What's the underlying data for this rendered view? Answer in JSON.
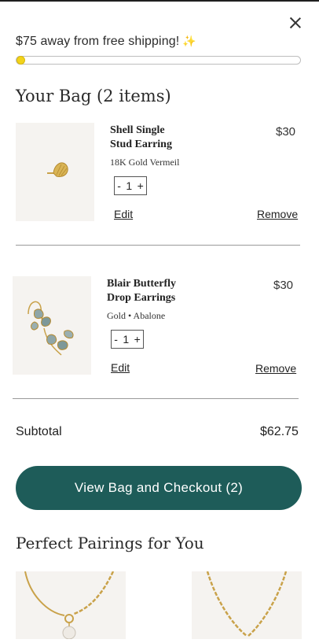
{
  "shipping": {
    "message": "$75 away from free shipping!",
    "sparkle": "✨",
    "progress_fraction": 0.0
  },
  "bag": {
    "title": "Your Bag (2 items)",
    "items": [
      {
        "name": "Shell Single Stud Earring",
        "variant": "18K Gold Vermeil",
        "price": "$30",
        "qty": "1",
        "minus": "-",
        "plus": "+",
        "edit": "Edit",
        "remove": "Remove",
        "image": "shell-stud-earring"
      },
      {
        "name": "Blair Butterfly Drop Earrings",
        "variant": "Gold • Abalone",
        "price": "$30",
        "qty": "1",
        "minus": "-",
        "plus": "+",
        "edit": "Edit",
        "remove": "Remove",
        "image": "butterfly-drop-earrings"
      }
    ]
  },
  "summary": {
    "subtotal_label": "Subtotal",
    "subtotal_value": "$62.75"
  },
  "checkout": {
    "label": "View Bag and Checkout (2)"
  },
  "pairings": {
    "title": "Perfect Pairings for You",
    "items": [
      "pearl-pendant-necklace",
      "gold-chain-necklace"
    ]
  },
  "colors": {
    "accent": "#1e5c59",
    "progress_dot": "#f2d31b"
  }
}
